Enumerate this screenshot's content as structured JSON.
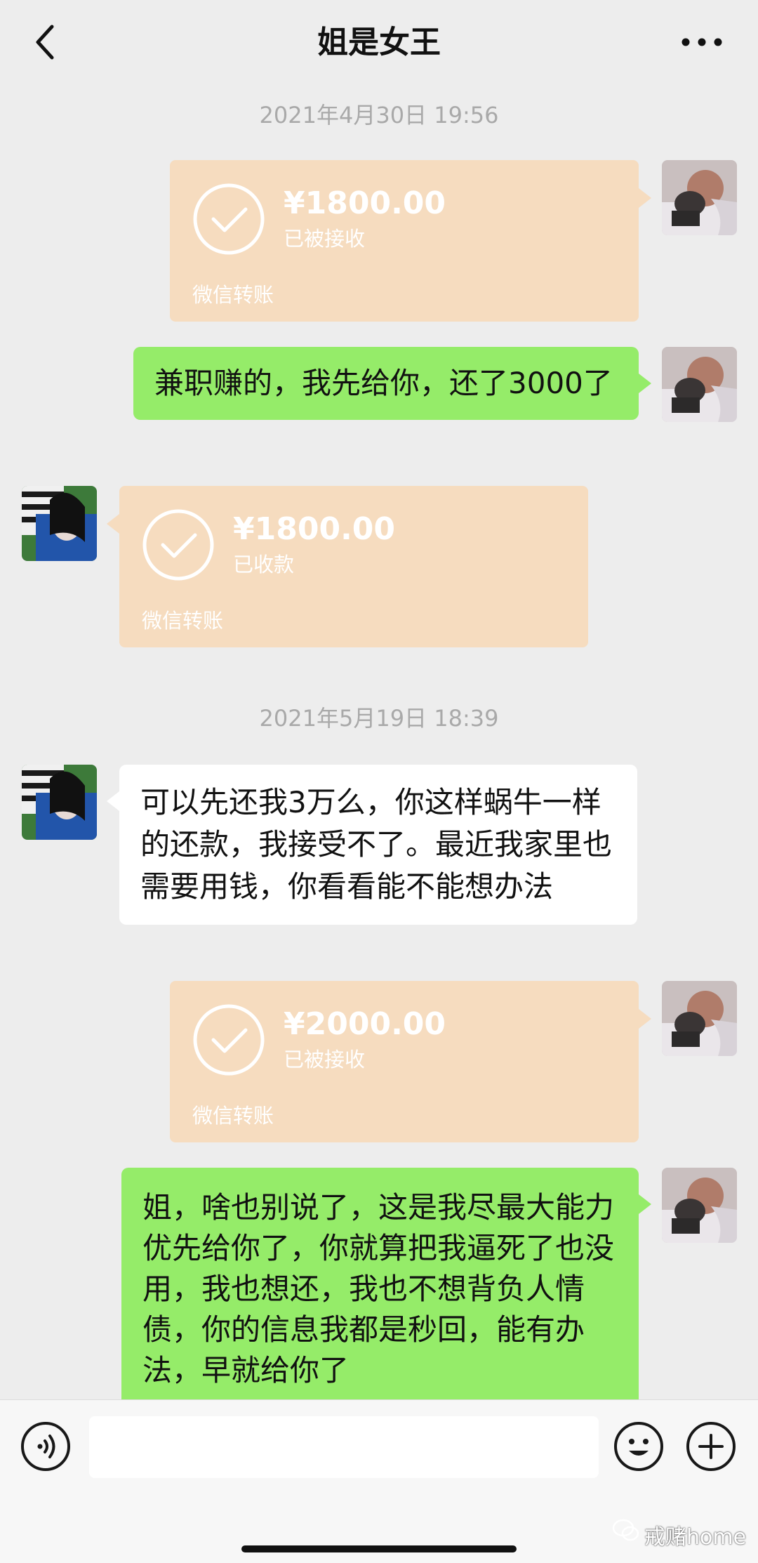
{
  "header": {
    "title": "姐是女王"
  },
  "colors": {
    "background": "#ededed",
    "transfer_card": "#f6dcbf",
    "outgoing_bubble": "#95ec69",
    "incoming_bubble": "#ffffff"
  },
  "messages": [
    {
      "type": "time",
      "text": "2021年4月30日 19:56"
    },
    {
      "type": "transfer",
      "side": "right",
      "amount": "¥1800.00",
      "status": "已被接收",
      "brand": "微信转账"
    },
    {
      "type": "text",
      "side": "right",
      "text": "兼职赚的，我先给你，还了3000了"
    },
    {
      "type": "transfer",
      "side": "left",
      "amount": "¥1800.00",
      "status": "已收款",
      "brand": "微信转账"
    },
    {
      "type": "time",
      "text": "2021年5月19日 18:39"
    },
    {
      "type": "text",
      "side": "left",
      "text": "可以先还我3万么，你这样蜗牛一样的还款，我接受不了。最近我家里也需要用钱，你看看能不能想办法"
    },
    {
      "type": "transfer",
      "side": "right",
      "amount": "¥2000.00",
      "status": "已被接收",
      "brand": "微信转账"
    },
    {
      "type": "text",
      "side": "right",
      "text": "姐，啥也别说了，这是我尽最大能力优先给你了，你就算把我逼死了也没用，我也想还，我也不想背负人情债，你的信息我都是秒回，能有办法，早就给你了"
    }
  ],
  "input_bar": {
    "value": "",
    "icons": [
      "voice-icon",
      "emoji-icon",
      "plus-icon"
    ]
  },
  "watermark": {
    "text": "戒赌home"
  }
}
